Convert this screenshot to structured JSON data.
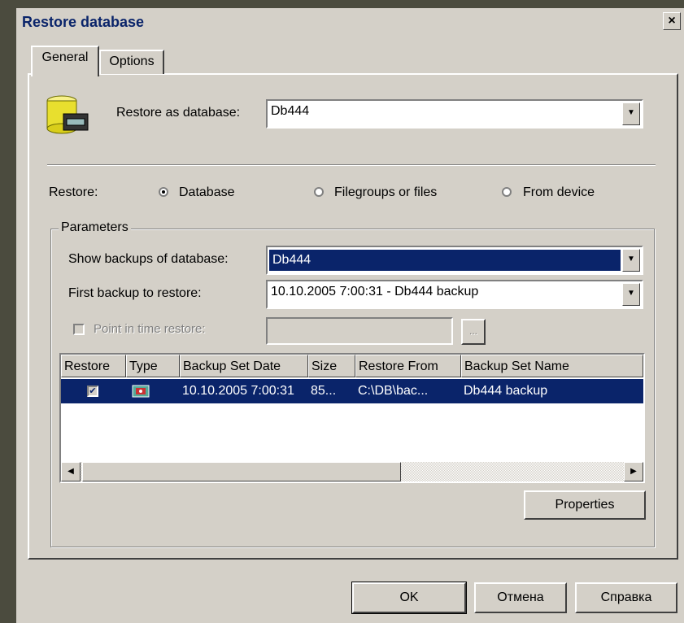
{
  "window": {
    "title": "Restore database",
    "close_glyph": "×"
  },
  "tabs": [
    {
      "label": "General"
    },
    {
      "label": "Options"
    }
  ],
  "restore_as": {
    "label": "Restore as database:",
    "value": "Db444",
    "icon": "database-icon"
  },
  "restore": {
    "label": "Restore:",
    "options": [
      {
        "label": "Database",
        "selected": true
      },
      {
        "label": "Filegroups or files",
        "selected": false
      },
      {
        "label": "From device",
        "selected": false
      }
    ]
  },
  "parameters": {
    "legend": "Parameters",
    "show_backups_label": "Show backups of database:",
    "show_backups_value": "Db444",
    "first_backup_label": "First backup to restore:",
    "first_backup_value": "10.10.2005 7:00:31 - Db444 backup",
    "point_in_time_label": "Point in time restore:",
    "point_in_time_value": "",
    "browse_label": "..."
  },
  "grid": {
    "columns": [
      "Restore",
      "Type",
      "Backup Set Date",
      "Size",
      "Restore From",
      "Backup Set Name"
    ],
    "rows": [
      {
        "restore_checked": true,
        "type_icon": "backup-type-icon",
        "date": "10.10.2005 7:00:31",
        "size": "85...",
        "from": "C:\\DB\\bac...",
        "name": "Db444 backup"
      }
    ]
  },
  "buttons": {
    "properties": "Properties",
    "ok": "OK",
    "cancel": "Отмена",
    "help": "Справка"
  },
  "colors": {
    "selection": "#0a246a",
    "face": "#d4d0c8",
    "outer_background": "#4b4b3e"
  }
}
